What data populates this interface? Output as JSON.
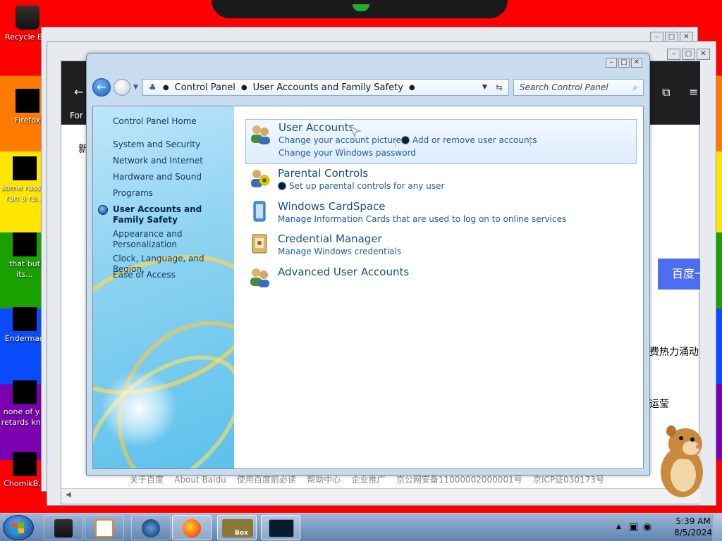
{
  "desktop": {
    "icons": [
      {
        "name": "recycle-bin",
        "label": "Recycle B..."
      },
      {
        "name": "firefox",
        "label": "Firefox"
      },
      {
        "name": "some-file",
        "label": "some russ... ran a ra..."
      },
      {
        "name": "that-but",
        "label": "that but its..."
      },
      {
        "name": "enderman",
        "label": "Enderman"
      },
      {
        "name": "none-of",
        "label": "none of y... retards kn..."
      },
      {
        "name": "chomik",
        "label": "ChomikB..."
      }
    ]
  },
  "browser_bg": {
    "for_text": "For c",
    "left_char": "新",
    "baidu_button": "百度一",
    "right_text_1": "费热力涌动",
    "right_text_2": "运莹",
    "footer": [
      "关于百度",
      "About Baidu",
      "使用百度前必读",
      "帮助中心",
      "企业推广",
      "京公网安备11000002000001号",
      "京ICP证030173号"
    ]
  },
  "control_panel": {
    "breadcrumb": [
      "Control Panel",
      "User Accounts and Family Safety"
    ],
    "search_placeholder": "Search Control Panel",
    "sidebar": [
      {
        "label": "Control Panel Home",
        "current": false
      },
      {
        "label": "System and Security",
        "current": false
      },
      {
        "label": "Network and Internet",
        "current": false
      },
      {
        "label": "Hardware and Sound",
        "current": false
      },
      {
        "label": "Programs",
        "current": false
      },
      {
        "label": "User Accounts and Family Safety",
        "current": true
      },
      {
        "label": "Appearance and Personalization",
        "current": false
      },
      {
        "label": "Clock, Language, and Region",
        "current": false
      },
      {
        "label": "Ease of Access",
        "current": false
      }
    ],
    "categories": [
      {
        "title": "User Accounts",
        "links": [
          "Change your account picture",
          "Add or remove user accounts",
          "Change your Windows password"
        ]
      },
      {
        "title": "Parental Controls",
        "links": [
          "Set up parental controls for any user"
        ]
      },
      {
        "title": "Windows CardSpace",
        "links": [
          "Manage Information Cards that are used to log on to online services"
        ]
      },
      {
        "title": "Credential Manager",
        "links": [
          "Manage Windows credentials"
        ]
      },
      {
        "title": "Advanced User Accounts",
        "links": []
      }
    ]
  },
  "taskbar": {
    "time": "5:39 AM",
    "date": "8/5/2024",
    "box_label": "Box"
  },
  "colors": {
    "link": "#1e5aa8",
    "title": "#1a4f7a",
    "sidebar": "#17345f"
  }
}
